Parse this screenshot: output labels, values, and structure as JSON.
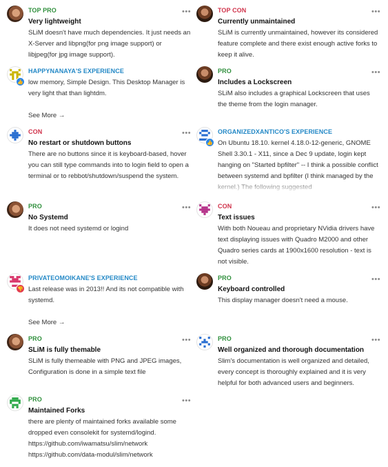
{
  "left": [
    {
      "avatar": "face",
      "label": "TOP PRO",
      "label_color": "green",
      "title": "Very lightweight",
      "text": "SLiM doesn't have much dependencies. It just needs an X-Server and libpng(for png image support) or libjpeg(for jpg image support)."
    },
    {
      "avatar": "pixel-yellow",
      "badge": "thumbs-up",
      "label": "HAPPYNANAYA'S EXPERIENCE",
      "label_color": "blue",
      "text": "low memory, Simple Design. This Desktop Manager is very light that than lightdm.",
      "see_more": "See More →"
    },
    {
      "avatar": "pixel-blue",
      "label": "CON",
      "label_color": "red",
      "title": "No restart or shutdown buttons",
      "text": "There are no buttons since it is keyboard-based, hover you can still type commands into to login field to open a terminal or to rebbot/shutdown/suspend the system."
    },
    {
      "avatar": "face",
      "label": "PRO",
      "label_color": "green",
      "title": "No Systemd",
      "text": "It does not need systemd or logind"
    },
    {
      "avatar": "pixel-red",
      "badge": "thumbs-down",
      "label": "PRIVATEOMOIKANE'S EXPERIENCE",
      "label_color": "blue",
      "text": "Last release was in 2013!! And its not compatible with systemd.",
      "see_more": "See More →"
    },
    {
      "avatar": "face",
      "label": "PRO",
      "label_color": "green",
      "title": "SLiM is fully themable",
      "text": "SLiM is fully themeable with PNG and JPEG images, Configuration is done in a simple text file"
    },
    {
      "avatar": "pixel-green",
      "label": "PRO",
      "label_color": "green",
      "title": "Maintained Forks",
      "text": "there are plenty of maintained forks available some dropped even consolekit for systemd/logind. https://github.com/iwamatsu/slim/network https://github.com/data-modul/slim/network"
    }
  ],
  "right": [
    {
      "avatar": "face2",
      "label": "TOP CON",
      "label_color": "red",
      "title": "Currently unmaintained",
      "text": "SLiM is currently unmaintained, however its considered feature complete and there exist enough active forks to keep it alive."
    },
    {
      "avatar": "face2",
      "label": "PRO",
      "label_color": "green",
      "title": "Includes a Lockscreen",
      "text": "SLiM also includes a graphical Lockscreen that uses the theme from the login manager."
    },
    {
      "avatar": "pixel-blue2",
      "badge": "thumbs-up",
      "label": "ORGANIZEDXANTICO'S EXPERIENCE",
      "label_color": "blue",
      "text": "On Ubuntu 18.10. kernel 4.18.0-12-generic, GNOME Shell 3.30.1 - X11, since a Dec 9 update, login kept hanging on \"Started bpfilter\" -- I think a possible conflict between systemd and bpfilter (I think managed by the kernel.) The following suggested"
    },
    {
      "avatar": "pixel-purple",
      "label": "CON",
      "label_color": "red",
      "title": "Text issues",
      "text": "With both Noueau and proprietary NVidia drivers have text displaying issues with Quadro M2000 and other Quadro series cards at 1900x1600 resolution - text is not visible."
    },
    {
      "avatar": "face2",
      "label": "PRO",
      "label_color": "green",
      "title": "Keyboard controlled",
      "text": "This display manager doesn't need a mouse."
    },
    {
      "avatar": "pixel-blue3",
      "label": "PRO",
      "label_color": "green",
      "title": "Well organized and thorough documentation",
      "text": "Slim's documentation is well organized and detailed, every concept is thoroughly explained and it is very helpful for both advanced users and beginners."
    }
  ],
  "more_options_icon": "•••",
  "colors": {
    "green": "#2f8f3c",
    "red": "#d0324a",
    "blue": "#2388c6",
    "thumbs_up": "#2a86e8",
    "thumbs_down": "#e23d4e"
  }
}
